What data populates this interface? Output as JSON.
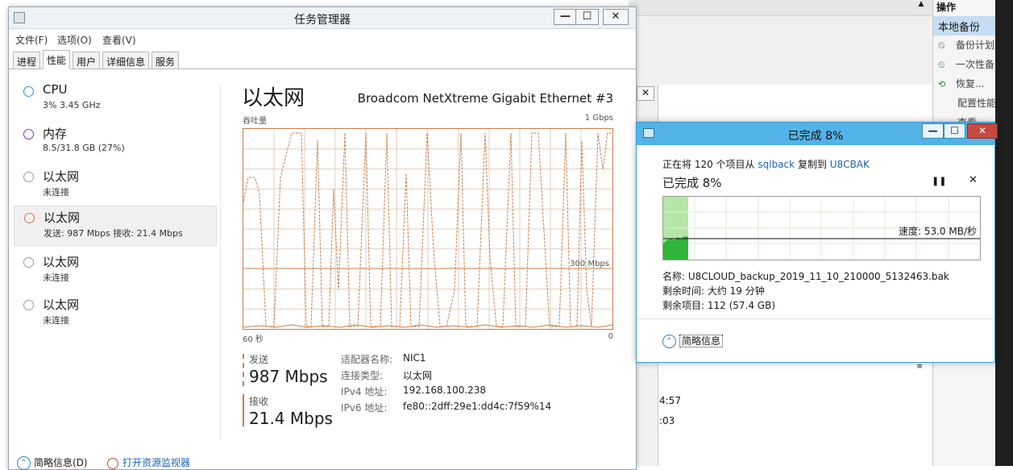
{
  "right_panel": {
    "header": "操作",
    "selected": "本地备份",
    "items": [
      {
        "label": "备份计划",
        "icon": "backup-schedule-icon"
      },
      {
        "label": "一次性备",
        "icon": "backup-once-icon"
      },
      {
        "label": "恢复...",
        "icon": "recover-icon"
      },
      {
        "label": "配置性能",
        "icon": ""
      },
      {
        "label": "查看",
        "icon": ""
      }
    ]
  },
  "background_fragments": {
    "time1": "4:57",
    "time2": ":03"
  },
  "task_manager": {
    "title": "任务管理器",
    "buttons": {
      "minimize": "—",
      "maximize": "☐",
      "close": "✕"
    },
    "menu": [
      "文件(F)",
      "选项(O)",
      "查看(V)"
    ],
    "tabs": [
      "进程",
      "性能",
      "用户",
      "详细信息",
      "服务"
    ],
    "active_tab": "性能",
    "sidebar": [
      {
        "name": "CPU",
        "sub": "3% 3.45 GHz",
        "color": "#2b8fd6"
      },
      {
        "name": "内存",
        "sub": "8.5/31.8 GB (27%)",
        "color": "#8e2fb5"
      },
      {
        "name": "以太网",
        "sub": "未连接",
        "color": "#a0a0a0"
      },
      {
        "name": "以太网",
        "sub": "发送: 987 Mbps 接收: 21.4 Mbps",
        "color": "#c77e4c"
      },
      {
        "name": "以太网",
        "sub": "未连接",
        "color": "#a0a0a0"
      },
      {
        "name": "以太网",
        "sub": "未连接",
        "color": "#a0a0a0"
      }
    ],
    "detail": {
      "title": "以太网",
      "adapter": "Broadcom NetXtreme Gigabit Ethernet #3",
      "throughput_label": "吞吐量",
      "max_label": "1 Gbps",
      "mid_label": "300 Mbps",
      "time_label": "60 秒",
      "zero_label": "0",
      "send_label": "发送",
      "send_value": "987 Mbps",
      "recv_label": "接收",
      "recv_value": "21.4 Mbps",
      "info": [
        {
          "k": "适配器名称:",
          "v": "NIC1"
        },
        {
          "k": "连接类型:",
          "v": "以太网"
        },
        {
          "k": "IPv4 地址:",
          "v": "192.168.100.238"
        },
        {
          "k": "IPv6 地址:",
          "v": "fe80::2dff:29e1:dd4c:7f59%14"
        }
      ]
    },
    "footer": {
      "less_info": "简略信息(D)",
      "resource_monitor": "打开资源监视器"
    }
  },
  "copy_dialog": {
    "title": "已完成 8%",
    "desc_prefix": "正在将 120 个项目从",
    "source": "sqlback",
    "desc_mid": "复制到",
    "dest": "U8CBAK",
    "percent": "已完成 8%",
    "progress": 0.08,
    "speed": "速度: 53.0 MB/秒",
    "name": "名称: U8CLOUD_backup_2019_11_10_210000_5132463.bak",
    "time_left": "剩余时间: 大约 19 分钟",
    "items_left": "剩余项目: 112 (57.4 GB)",
    "less_info": "简略信息",
    "pause_icon": "pause-icon",
    "cancel_icon": "close-icon"
  },
  "colors": {
    "ethernet": "#c77e4c",
    "dialog_title": "#53b3e6",
    "progress_green": "#2fb53a"
  }
}
